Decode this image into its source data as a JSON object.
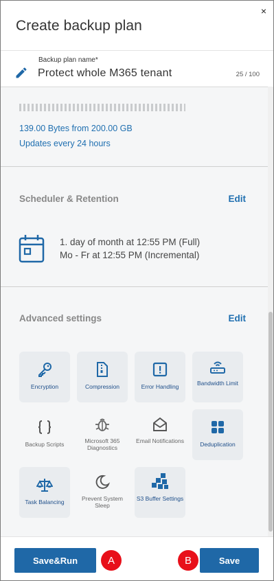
{
  "dialog": {
    "title": "Create backup plan",
    "close_glyph": "×"
  },
  "plan_name": {
    "label": "Backup plan name*",
    "value": "Protect whole M365 tenant",
    "counter": "25 / 100"
  },
  "usage": {
    "amount_text": "139.00 Bytes from 200.00 GB",
    "update_text": "Updates every 24 hours"
  },
  "scheduler": {
    "title": "Scheduler & Retention",
    "edit_label": "Edit",
    "line1": "1. day of month at 12:55 PM (Full)",
    "line2": "Mo - Fr at 12:55 PM (Incremental)"
  },
  "advanced": {
    "title": "Advanced settings",
    "edit_label": "Edit",
    "tiles": [
      {
        "label": "Encryption",
        "icon": "key-icon",
        "enabled": true
      },
      {
        "label": "Compression",
        "icon": "zip-file-icon",
        "enabled": true
      },
      {
        "label": "Error Handling",
        "icon": "alert-icon",
        "enabled": true
      },
      {
        "label": "Bandwidth Limit",
        "icon": "router-icon",
        "enabled": true
      },
      {
        "label": "Backup Scripts",
        "icon": "braces-icon",
        "enabled": false
      },
      {
        "label": "Microsoft 365 Diagnostics",
        "icon": "bug-icon",
        "enabled": false
      },
      {
        "label": "Email Notifications",
        "icon": "envelope-icon",
        "enabled": false
      },
      {
        "label": "Deduplication",
        "icon": "grid-icon",
        "enabled": true
      },
      {
        "label": "Task Balancing",
        "icon": "scales-icon",
        "enabled": true
      },
      {
        "label": "Prevent System Sleep",
        "icon": "moon-icon",
        "enabled": false
      },
      {
        "label": "S3 Buffer Settings",
        "icon": "cubes-icon",
        "enabled": true
      }
    ]
  },
  "footer": {
    "save_run_label": "Save&Run",
    "save_label": "Save",
    "badge_a": "A",
    "badge_b": "B"
  },
  "colors": {
    "accent": "#1f68a7",
    "link": "#1f6fb0",
    "badge": "#e8101a",
    "tile_bg": "#e9ecef"
  }
}
